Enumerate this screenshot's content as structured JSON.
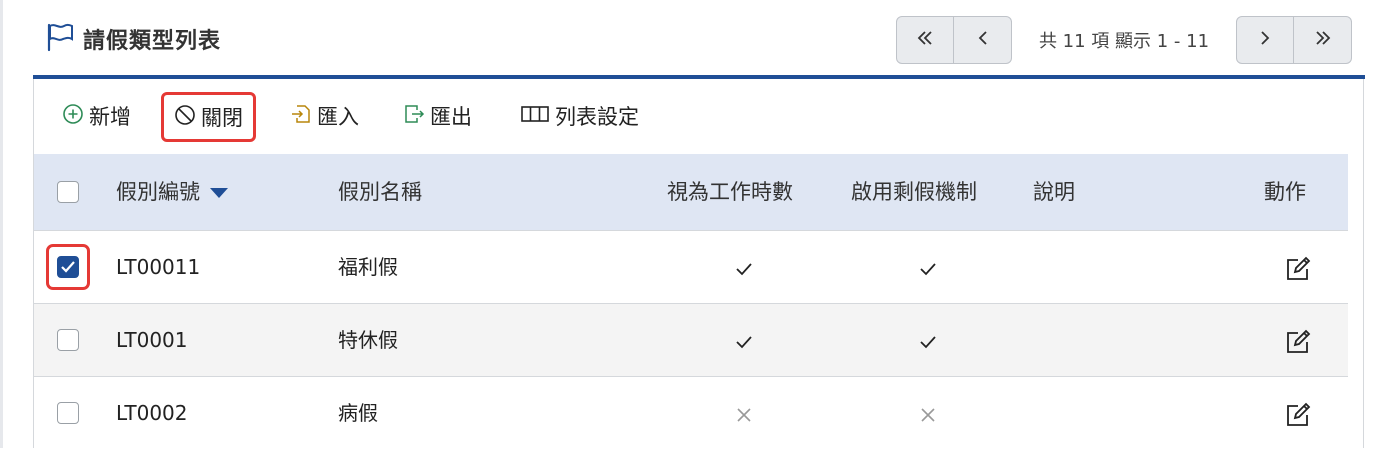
{
  "header": {
    "title": "請假類型列表",
    "pager_info": "共 11 項 顯示 1 - 11"
  },
  "toolbar": {
    "add_label": "新增",
    "close_label": "關閉",
    "import_label": "匯入",
    "export_label": "匯出",
    "columns_label": "列表設定"
  },
  "table": {
    "headers": {
      "code": "假別編號",
      "name": "假別名稱",
      "work_hours": "視為工作時數",
      "remaining": "啟用剩假機制",
      "desc": "說明",
      "action": "動作"
    },
    "sort": {
      "column": "code",
      "direction": "desc"
    },
    "rows": [
      {
        "code": "LT00011",
        "name": "福利假",
        "work_hours": true,
        "remaining": true,
        "desc": "",
        "selected": true
      },
      {
        "code": "LT0001",
        "name": "特休假",
        "work_hours": true,
        "remaining": true,
        "desc": "",
        "selected": false
      },
      {
        "code": "LT0002",
        "name": "病假",
        "work_hours": false,
        "remaining": false,
        "desc": "",
        "selected": false
      }
    ]
  },
  "colors": {
    "accent": "#1f4e96",
    "highlight": "#e53935",
    "header_bg": "#dfe6f3",
    "alt_row_bg": "#f4f4f4",
    "add_icon": "#2e8b57",
    "import_export_icon": "#b8860b"
  }
}
